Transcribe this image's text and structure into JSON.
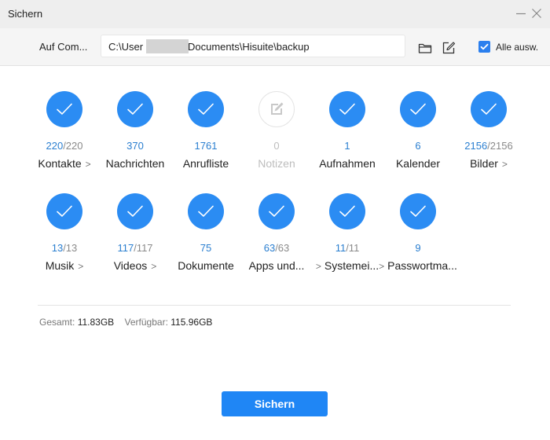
{
  "window": {
    "title": "Sichern"
  },
  "path_bar": {
    "label": "Auf Com...",
    "path_prefix": "C:\\User",
    "path_suffix": "Documents\\Hisuite\\backup",
    "select_all_label": "Alle ausw.",
    "select_all_checked": true
  },
  "items": [
    {
      "name": "Kontakte",
      "selected": "220",
      "total": "/220",
      "arrow": ">",
      "checked": true
    },
    {
      "name": "Nachrichten",
      "selected": "370",
      "total": "",
      "arrow": "",
      "checked": true
    },
    {
      "name": "Anrufliste",
      "selected": "1761",
      "total": "",
      "arrow": "",
      "checked": true
    },
    {
      "name": "Notizen",
      "selected": "0",
      "total": "",
      "arrow": "",
      "checked": false
    },
    {
      "name": "Aufnahmen",
      "selected": "1",
      "total": "",
      "arrow": "",
      "checked": true
    },
    {
      "name": "Kalender",
      "selected": "6",
      "total": "",
      "arrow": "",
      "checked": true
    },
    {
      "name": "Bilder",
      "selected": "2156",
      "total": "/2156",
      "arrow": ">",
      "checked": true
    },
    {
      "name": "Musik",
      "selected": "13",
      "total": "/13",
      "arrow": ">",
      "checked": true
    },
    {
      "name": "Videos",
      "selected": "117",
      "total": "/117",
      "arrow": ">",
      "checked": true
    },
    {
      "name": "Dokumente",
      "selected": "75",
      "total": "",
      "arrow": "",
      "checked": true
    },
    {
      "name": "Apps und...",
      "selected": "63",
      "total": "/63",
      "arrow": ">",
      "checked": true
    },
    {
      "name": "Systemei...",
      "selected": "11",
      "total": "/11",
      "arrow": ">",
      "checked": true
    },
    {
      "name": "Passwortma...",
      "selected": "9",
      "total": "",
      "arrow": "",
      "checked": true
    }
  ],
  "storage": {
    "total_label": "Gesamt:",
    "total_value": "11.83GB",
    "free_label": "Verfügbar:",
    "free_value": "115.96GB"
  },
  "actions": {
    "primary_label": "Sichern"
  },
  "colors": {
    "accent": "#2b8cf3",
    "button": "#1f86f5",
    "selected_count": "#2b7fd0"
  },
  "icons": [
    "minimize-icon",
    "close-icon",
    "folder-icon",
    "edit-icon",
    "checkmark-icon",
    "note-edit-icon"
  ]
}
